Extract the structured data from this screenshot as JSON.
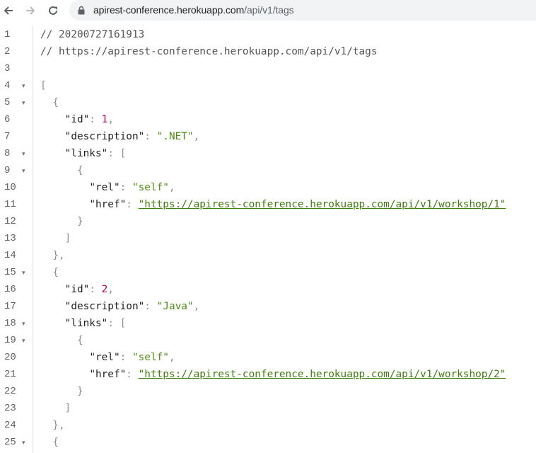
{
  "browser": {
    "back_icon": "arrow-left-icon",
    "forward_icon": "arrow-right-icon",
    "reload_icon": "reload-icon",
    "lock_icon": "lock-icon",
    "url_host": "apirest-conference.herokuapp.com",
    "url_path": "/api/v1/tags"
  },
  "viewer": {
    "line_numbers": [
      "1",
      "2",
      "3",
      "4",
      "5",
      "6",
      "7",
      "8",
      "9",
      "10",
      "11",
      "12",
      "13",
      "14",
      "15",
      "16",
      "17",
      "18",
      "19",
      "20",
      "21",
      "22",
      "23",
      "24",
      "25"
    ],
    "foldable_lines": [
      4,
      5,
      8,
      9,
      15,
      18,
      19,
      25
    ],
    "comment_timestamp": "// 20200727161913",
    "comment_url": "// https://apirest-conference.herokuapp.com/api/v1/tags",
    "tags": [
      {
        "id": "1",
        "description": "\".NET\"",
        "rel": "\"self\"",
        "href": "\"https://apirest-conference.herokuapp.com/api/v1/workshop/1\""
      },
      {
        "id": "2",
        "description": "\"Java\"",
        "rel": "\"self\"",
        "href": "\"https://apirest-conference.herokuapp.com/api/v1/workshop/2\""
      }
    ],
    "keys": {
      "id": "\"id\"",
      "description": "\"description\"",
      "links": "\"links\"",
      "rel": "\"rel\"",
      "href": "\"href\""
    },
    "punct": {
      "open_bracket": "[",
      "close_bracket": "]",
      "open_brace": "{",
      "close_brace": "}",
      "close_brace_comma": "},",
      "colon": ": ",
      "comma": ",",
      "colon_bracket": ": ["
    }
  }
}
